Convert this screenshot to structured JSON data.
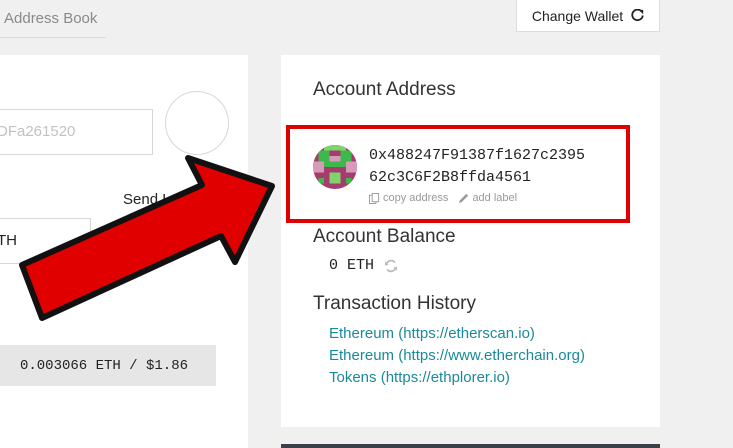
{
  "nav": {
    "address_book_tab": "Address Book"
  },
  "header": {
    "change_wallet_label": "Change Wallet"
  },
  "send_form": {
    "to_address_value": "DFa261520",
    "send_later_label": "Send Later",
    "amount_unit": "TH",
    "fee_text": "0.003066 ETH / $1.86"
  },
  "account": {
    "address_heading": "Account Address",
    "address_line1": "0x488247F91387f1627c2395",
    "address_line2": "62c3C6F2B8ffda4561",
    "copy_label": "copy address",
    "add_label": "add label",
    "balance_heading": "Account Balance",
    "balance_value": "0 ETH",
    "history_heading": "Transaction History",
    "links": [
      "Ethereum (https://etherscan.io)",
      "Ethereum (https://www.etherchain.org)",
      "Tokens (https://ethplorer.io)"
    ]
  },
  "colors": {
    "accent_link": "#1a8a9a",
    "annotation_red": "#e10000"
  },
  "icons": [
    "refresh-icon",
    "copy-icon",
    "pencil-icon",
    "identicon"
  ]
}
